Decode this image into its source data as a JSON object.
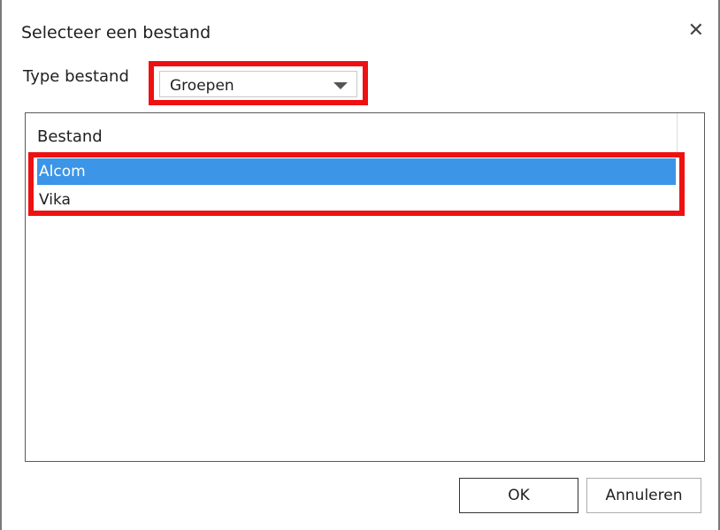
{
  "dialog": {
    "title": "Selecteer een bestand",
    "close_icon": "close-icon"
  },
  "type_select": {
    "label": "Type bestand",
    "value": "Groepen"
  },
  "file_list": {
    "column_header": "Bestand",
    "items": [
      {
        "label": "Alcom",
        "selected": true
      },
      {
        "label": "Vika",
        "selected": false
      }
    ]
  },
  "buttons": {
    "ok": "OK",
    "cancel": "Annuleren"
  },
  "colors": {
    "selection": "#3c95e6",
    "highlight_annotation": "#ee1111"
  }
}
